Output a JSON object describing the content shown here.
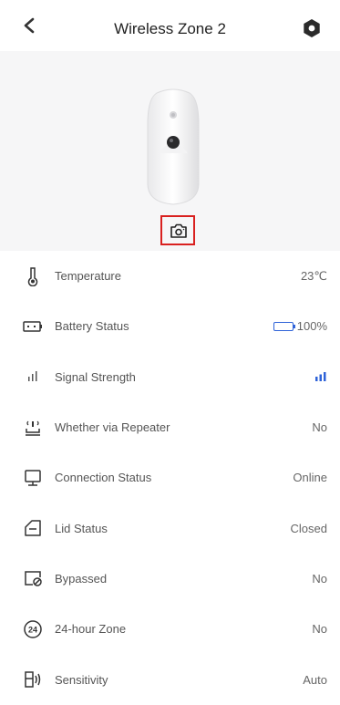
{
  "header": {
    "title": "Wireless Zone 2",
    "back_icon": "chevron-left-icon",
    "settings_icon": "gear-icon"
  },
  "hero": {
    "device_image": "motion-detector-camera-image",
    "capture_icon": "camera-capture-icon",
    "capture_border_color": "#d9201f"
  },
  "rows": [
    {
      "icon": "thermometer-icon",
      "label": "Temperature",
      "value": "23℃"
    },
    {
      "icon": "battery-icon",
      "label": "Battery Status",
      "value": "100%",
      "battery_level": 1.0,
      "battery_color": "#2f63d8"
    },
    {
      "icon": "signal-icon",
      "label": "Signal Strength",
      "value": "",
      "signal_bars": 3,
      "signal_color": "#2f63d8"
    },
    {
      "icon": "repeater-icon",
      "label": "Whether via Repeater",
      "value": "No"
    },
    {
      "icon": "monitor-icon",
      "label": "Connection Status",
      "value": "Online"
    },
    {
      "icon": "lid-icon",
      "label": "Lid Status",
      "value": "Closed"
    },
    {
      "icon": "bypass-icon",
      "label": "Bypassed",
      "value": "No"
    },
    {
      "icon": "24h-zone-icon",
      "label": "24-hour Zone",
      "value": "No",
      "icon_text": "24"
    },
    {
      "icon": "sensitivity-icon",
      "label": "Sensitivity",
      "value": "Auto"
    }
  ]
}
